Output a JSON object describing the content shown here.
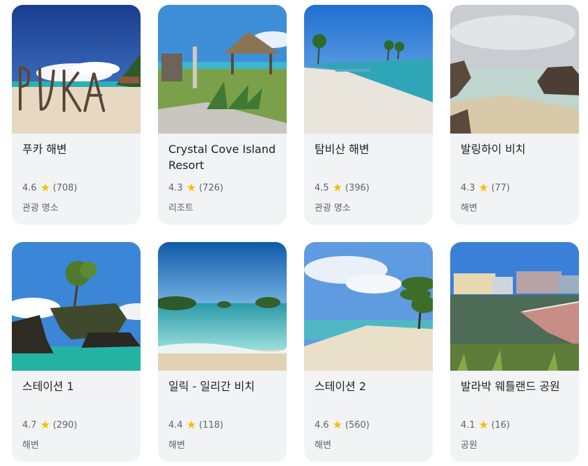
{
  "places": [
    {
      "name": "푸카 해변",
      "rating": "4.6",
      "reviews": "(708)",
      "category": "관광 명소",
      "photo_icon": "puka-beach-photo"
    },
    {
      "name": "Crystal Cove Island Resort",
      "rating": "4.3",
      "reviews": "(726)",
      "category": "리조트",
      "photo_icon": "crystal-cove-photo"
    },
    {
      "name": "탐비산 해변",
      "rating": "4.5",
      "reviews": "(396)",
      "category": "관광 명소",
      "photo_icon": "tambisaan-beach-photo"
    },
    {
      "name": "발링하이 비치",
      "rating": "4.3",
      "reviews": "(77)",
      "category": "해변",
      "photo_icon": "balinghai-beach-photo"
    },
    {
      "name": "스테이션 1",
      "rating": "4.7",
      "reviews": "(290)",
      "category": "해변",
      "photo_icon": "station1-photo"
    },
    {
      "name": "일릭 - 일리간 비치",
      "rating": "4.4",
      "reviews": "(118)",
      "category": "해변",
      "photo_icon": "ilig-iligan-beach-photo"
    },
    {
      "name": "스테이션 2",
      "rating": "4.6",
      "reviews": "(560)",
      "category": "해변",
      "photo_icon": "station2-photo"
    },
    {
      "name": "발라박 웨틀랜드 공원",
      "rating": "4.1",
      "reviews": "(16)",
      "category": "공원",
      "photo_icon": "balabag-wetland-photo"
    }
  ],
  "star_glyph": "★",
  "colors": {
    "card_bg": "#f1f3f4",
    "star": "#fbbc04",
    "text": "#202124",
    "muted": "#5f6368"
  }
}
